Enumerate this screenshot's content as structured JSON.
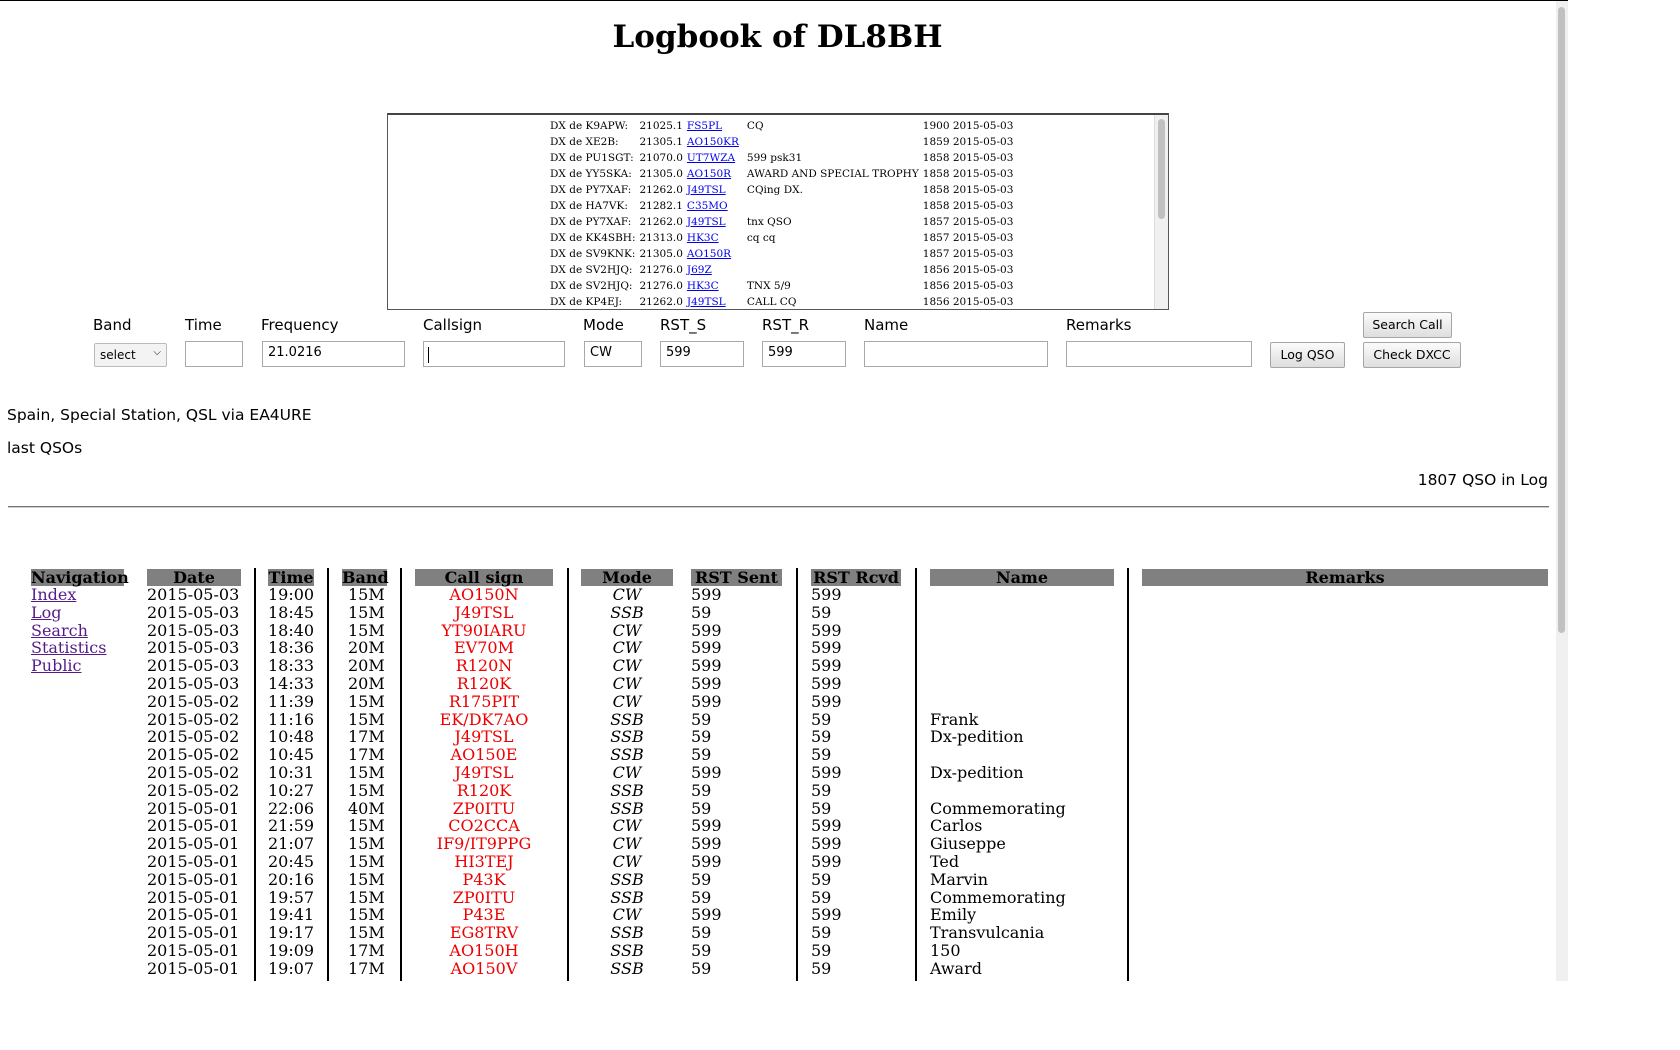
{
  "page": {
    "title": "Logbook of DL8BH"
  },
  "dxcluster": [
    {
      "spotter": "DX de K9APW:",
      "freq": "21025.1",
      "call": "FS5PL",
      "comment": "CQ",
      "time": "1900 2015-05-03"
    },
    {
      "spotter": "DX de XE2B:",
      "freq": "21305.1",
      "call": "AO150KR",
      "comment": "",
      "time": "1859 2015-05-03"
    },
    {
      "spotter": "DX de PU1SGT:",
      "freq": "21070.0",
      "call": "UT7WZA",
      "comment": "599 psk31",
      "time": "1858 2015-05-03"
    },
    {
      "spotter": "DX de YY5SKA:",
      "freq": "21305.0",
      "call": "AO150R",
      "comment": "AWARD AND SPECIAL TROPHY",
      "time": "1858 2015-05-03"
    },
    {
      "spotter": "DX de PY7XAF:",
      "freq": "21262.0",
      "call": "J49TSL",
      "comment": "CQing DX.",
      "time": "1858 2015-05-03"
    },
    {
      "spotter": "DX de HA7VK:",
      "freq": "21282.1",
      "call": "C35MO",
      "comment": "",
      "time": "1858 2015-05-03"
    },
    {
      "spotter": "DX de PY7XAF:",
      "freq": "21262.0",
      "call": "J49TSL",
      "comment": "tnx QSO",
      "time": "1857 2015-05-03"
    },
    {
      "spotter": "DX de KK4SBH:",
      "freq": "21313.0",
      "call": "HK3C",
      "comment": "cq cq",
      "time": "1857 2015-05-03"
    },
    {
      "spotter": "DX de SV9KNK:",
      "freq": "21305.0",
      "call": "AO150R",
      "comment": "",
      "time": "1857 2015-05-03"
    },
    {
      "spotter": "DX de SV2HJQ:",
      "freq": "21276.0",
      "call": "J69Z",
      "comment": "",
      "time": "1856 2015-05-03"
    },
    {
      "spotter": "DX de SV2HJQ:",
      "freq": "21276.0",
      "call": "HK3C",
      "comment": "TNX 5/9",
      "time": "1856 2015-05-03"
    },
    {
      "spotter": "DX de KP4EJ:",
      "freq": "21262.0",
      "call": "J49TSL",
      "comment": "CALL CQ",
      "time": "1856 2015-05-03"
    }
  ],
  "form": {
    "labels": {
      "band": "Band",
      "time": "Time",
      "frequency": "Frequency",
      "callsign": "Callsign",
      "mode": "Mode",
      "rst_s": "RST_S",
      "rst_r": "RST_R",
      "name": "Name",
      "remarks": "Remarks"
    },
    "values": {
      "band": "select",
      "time": "",
      "frequency": "21.0216",
      "callsign": "",
      "mode": "CW",
      "rst_s": "599",
      "rst_r": "599",
      "name": "",
      "remarks": ""
    },
    "buttons": {
      "log": "Log QSO",
      "search": "Search Call",
      "dxcc": "Check DXCC"
    }
  },
  "info": {
    "dxcc_result": "Spain, Special Station, QSL via EA4URE",
    "last_qsos": "last QSOs",
    "count": "1807 QSO in Log"
  },
  "table": {
    "headers": {
      "nav": "Navigation",
      "date": "Date",
      "time": "Time",
      "band": "Band",
      "call": "Call sign",
      "mode": "Mode",
      "rst_sent": "RST Sent",
      "rst_rcvd": "RST Rcvd",
      "name": "Name",
      "remarks": "Remarks"
    },
    "nav": [
      "Index",
      "Log",
      "Search",
      "Statistics",
      "Public"
    ],
    "rows": [
      {
        "date": "2015-05-03",
        "time": "19:00",
        "band": "15M",
        "call": "AO150N",
        "mode": "CW",
        "sent": "599",
        "rcvd": "599",
        "name": ""
      },
      {
        "date": "2015-05-03",
        "time": "18:45",
        "band": "15M",
        "call": "J49TSL",
        "mode": "SSB",
        "sent": "59",
        "rcvd": "59",
        "name": ""
      },
      {
        "date": "2015-05-03",
        "time": "18:40",
        "band": "15M",
        "call": "YT90IARU",
        "mode": "CW",
        "sent": "599",
        "rcvd": "599",
        "name": ""
      },
      {
        "date": "2015-05-03",
        "time": "18:36",
        "band": "20M",
        "call": "EV70M",
        "mode": "CW",
        "sent": "599",
        "rcvd": "599",
        "name": ""
      },
      {
        "date": "2015-05-03",
        "time": "18:33",
        "band": "20M",
        "call": "R120N",
        "mode": "CW",
        "sent": "599",
        "rcvd": "599",
        "name": ""
      },
      {
        "date": "2015-05-03",
        "time": "14:33",
        "band": "20M",
        "call": "R120K",
        "mode": "CW",
        "sent": "599",
        "rcvd": "599",
        "name": ""
      },
      {
        "date": "2015-05-02",
        "time": "11:39",
        "band": "15M",
        "call": "R175PIT",
        "mode": "CW",
        "sent": "599",
        "rcvd": "599",
        "name": ""
      },
      {
        "date": "2015-05-02",
        "time": "11:16",
        "band": "15M",
        "call": "EK/DK7AO",
        "mode": "SSB",
        "sent": "59",
        "rcvd": "59",
        "name": "Frank"
      },
      {
        "date": "2015-05-02",
        "time": "10:48",
        "band": "17M",
        "call": "J49TSL",
        "mode": "SSB",
        "sent": "59",
        "rcvd": "59",
        "name": "Dx-pedition"
      },
      {
        "date": "2015-05-02",
        "time": "10:45",
        "band": "17M",
        "call": "AO150E",
        "mode": "SSB",
        "sent": "59",
        "rcvd": "59",
        "name": ""
      },
      {
        "date": "2015-05-02",
        "time": "10:31",
        "band": "15M",
        "call": "J49TSL",
        "mode": "CW",
        "sent": "599",
        "rcvd": "599",
        "name": "Dx-pedition"
      },
      {
        "date": "2015-05-02",
        "time": "10:27",
        "band": "15M",
        "call": "R120K",
        "mode": "SSB",
        "sent": "59",
        "rcvd": "59",
        "name": ""
      },
      {
        "date": "2015-05-01",
        "time": "22:06",
        "band": "40M",
        "call": "ZP0ITU",
        "mode": "SSB",
        "sent": "59",
        "rcvd": "59",
        "name": "Commemorating"
      },
      {
        "date": "2015-05-01",
        "time": "21:59",
        "band": "15M",
        "call": "CO2CCA",
        "mode": "CW",
        "sent": "599",
        "rcvd": "599",
        "name": "Carlos"
      },
      {
        "date": "2015-05-01",
        "time": "21:07",
        "band": "15M",
        "call": "IF9/IT9PPG",
        "mode": "CW",
        "sent": "599",
        "rcvd": "599",
        "name": "Giuseppe"
      },
      {
        "date": "2015-05-01",
        "time": "20:45",
        "band": "15M",
        "call": "HI3TEJ",
        "mode": "CW",
        "sent": "599",
        "rcvd": "599",
        "name": "Ted"
      },
      {
        "date": "2015-05-01",
        "time": "20:16",
        "band": "15M",
        "call": "P43K",
        "mode": "SSB",
        "sent": "59",
        "rcvd": "59",
        "name": "Marvin"
      },
      {
        "date": "2015-05-01",
        "time": "19:57",
        "band": "15M",
        "call": "ZP0ITU",
        "mode": "SSB",
        "sent": "59",
        "rcvd": "59",
        "name": "Commemorating"
      },
      {
        "date": "2015-05-01",
        "time": "19:41",
        "band": "15M",
        "call": "P43E",
        "mode": "CW",
        "sent": "599",
        "rcvd": "599",
        "name": "Emily"
      },
      {
        "date": "2015-05-01",
        "time": "19:17",
        "band": "15M",
        "call": "EG8TRV",
        "mode": "SSB",
        "sent": "59",
        "rcvd": "59",
        "name": "Transvulcania"
      },
      {
        "date": "2015-05-01",
        "time": "19:09",
        "band": "17M",
        "call": "AO150H",
        "mode": "SSB",
        "sent": "59",
        "rcvd": "59",
        "name": "150"
      },
      {
        "date": "2015-05-01",
        "time": "19:07",
        "band": "17M",
        "call": "AO150V",
        "mode": "SSB",
        "sent": "59",
        "rcvd": "59",
        "name": "Award"
      }
    ]
  },
  "colors": {
    "callsign": "#e00000",
    "header_bg": "#808080",
    "link": "#0000ee",
    "visited": "#551a8b"
  }
}
